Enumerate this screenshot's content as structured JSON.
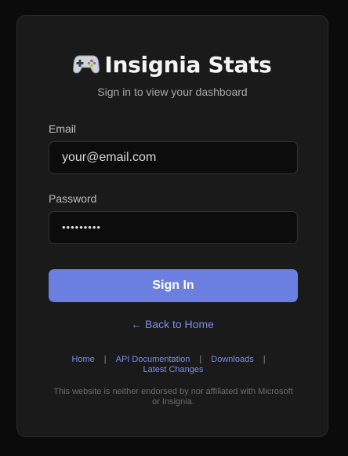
{
  "header": {
    "title": "Insignia Stats",
    "subtitle": "Sign in to view your dashboard",
    "icon": "gamepad-icon"
  },
  "form": {
    "email_label": "Email",
    "email_placeholder": "your@email.com",
    "password_label": "Password",
    "password_value": "•••••••••",
    "submit_label": "Sign In"
  },
  "back_link": "← Back to Home",
  "footer": {
    "links": [
      "Home",
      "API Documentation",
      "Downloads",
      "Latest Changes"
    ],
    "separator": "|",
    "disclaimer": "This website is neither endorsed by nor affiliated with Microsoft or Insignia."
  },
  "colors": {
    "accent": "#6b7fe0",
    "link": "#7a8cf0",
    "card_bg": "#1a1a1a",
    "page_bg": "#0b0b0b"
  }
}
